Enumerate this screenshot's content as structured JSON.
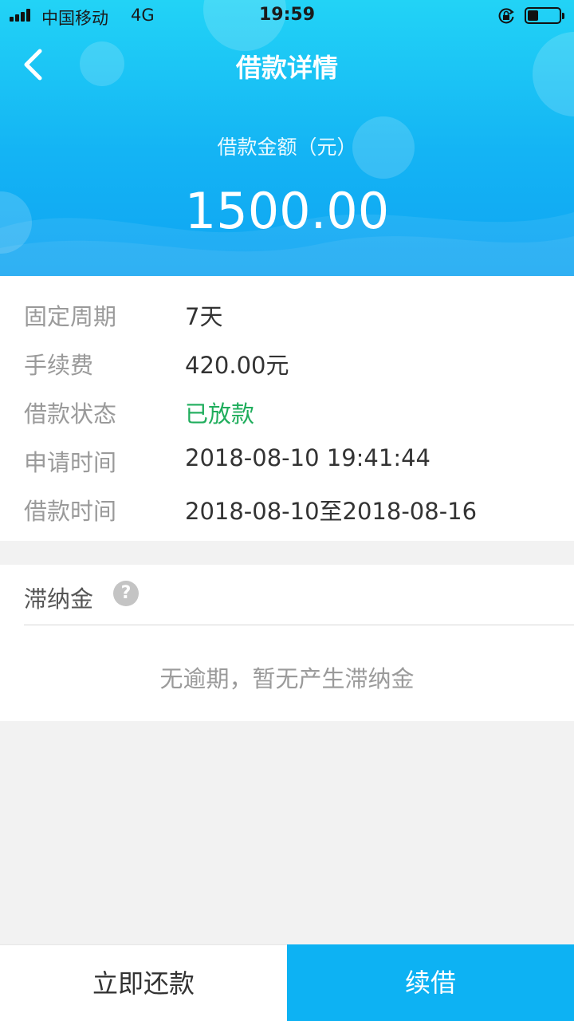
{
  "status_bar": {
    "carrier": "中国移动",
    "network": "4G",
    "time": "19:59",
    "battery_level": 0.35
  },
  "nav": {
    "back_icon": "chevron-left-icon",
    "title": "借款详情"
  },
  "summary": {
    "amount_label": "借款金额（元）",
    "amount": "1500.00"
  },
  "details": [
    {
      "label": "固定周期",
      "value": "7天"
    },
    {
      "label": "手续费",
      "value": "420.00元"
    },
    {
      "label": "借款状态",
      "value": "已放款"
    },
    {
      "label": "申请时间",
      "value": "2018-08-10 19:41:44"
    },
    {
      "label": "借款时间",
      "value": "2018-08-10至2018-08-16"
    }
  ],
  "late_fee": {
    "title": "滞纳金",
    "help_icon": "question-mark-icon",
    "help_glyph": "?",
    "message": "无逾期，暂无产生滞纳金"
  },
  "actions": {
    "repay_label": "立即还款",
    "renew_label": "续借"
  },
  "colors": {
    "header_top": "#22d3f6",
    "header_bottom": "#0fa4f2",
    "status_green": "#1fad5c",
    "renew_button": "#0db2f3"
  }
}
